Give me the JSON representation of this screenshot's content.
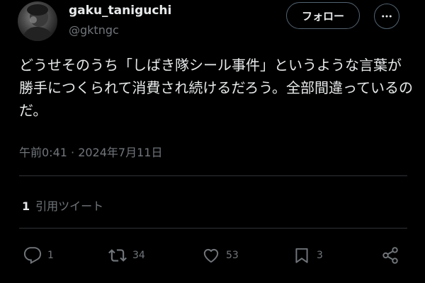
{
  "author": {
    "display_name": "gaku_taniguchi",
    "handle": "@gktngc"
  },
  "header": {
    "follow_label": "フォロー",
    "more_icon": "more-horizontal-icon"
  },
  "tweet": {
    "text": "どうせそのうち「しばき隊シール事件」というような言葉が勝手につくられて消費され続けるだろう。全部間違っているのだ。",
    "timestamp": "午前0:41 · 2024年7月11日"
  },
  "engagement": {
    "quote_count": "1",
    "quote_label": "引用ツイート"
  },
  "actions": {
    "reply": {
      "icon": "reply-icon",
      "count": "1"
    },
    "retweet": {
      "icon": "retweet-icon",
      "count": "34"
    },
    "like": {
      "icon": "heart-icon",
      "count": "53"
    },
    "bookmark": {
      "icon": "bookmark-icon",
      "count": "3"
    },
    "share": {
      "icon": "share-icon"
    }
  },
  "colors": {
    "background": "#000000",
    "primary_text": "#e7e9ea",
    "secondary_text": "#71767b",
    "border": "#536471",
    "divider": "#2f3336"
  }
}
